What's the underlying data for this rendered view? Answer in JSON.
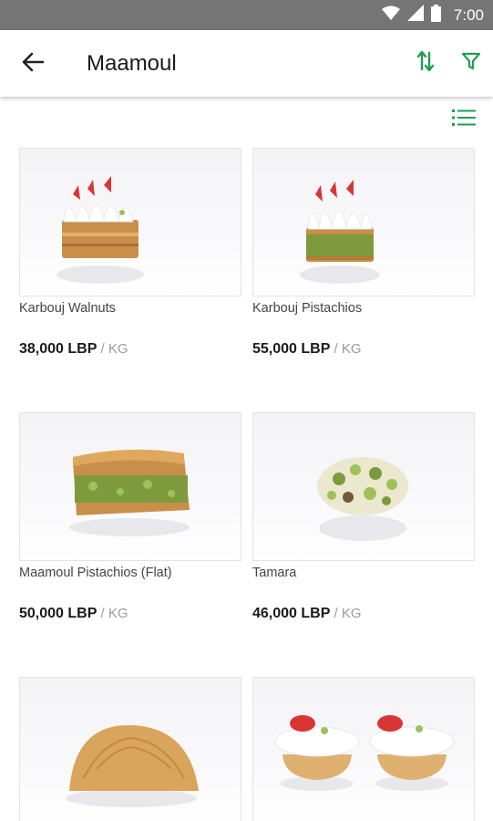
{
  "status_bar": {
    "time": "7:00"
  },
  "header": {
    "title": "Maamoul",
    "back_icon": "arrow-left-icon",
    "sort_icon": "sort-arrows-icon",
    "filter_icon": "filter-funnel-icon",
    "accent_color": "#1f9d55"
  },
  "view_toggle": {
    "icon": "list-view-icon"
  },
  "products": [
    {
      "name": "Karbouj Walnuts",
      "price": "38,000 LBP",
      "unit": " / KG"
    },
    {
      "name": "Karbouj Pistachios",
      "price": "55,000 LBP",
      "unit": " / KG"
    },
    {
      "name": "Maamoul Pistachios (Flat)",
      "price": "50,000 LBP",
      "unit": " / KG"
    },
    {
      "name": "Tamara",
      "price": "46,000 LBP",
      "unit": " / KG"
    },
    {
      "name": "",
      "price": "",
      "unit": ""
    },
    {
      "name": "",
      "price": "",
      "unit": ""
    }
  ]
}
